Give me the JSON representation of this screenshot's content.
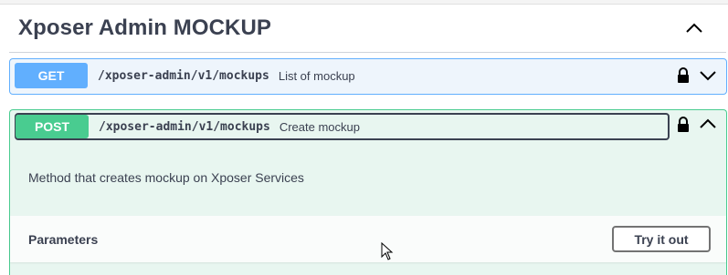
{
  "section": {
    "title": "Xposer Admin MOCKUP",
    "collapse_icon": "chevron-up-icon"
  },
  "operations": [
    {
      "method": "GET",
      "path": "/xposer-admin/v1/mockups",
      "summary": "List of mockup",
      "color": "#61affe",
      "background": "#eef5fc",
      "expanded": false,
      "icons": [
        "lock-icon",
        "chevron-down-icon"
      ]
    },
    {
      "method": "POST",
      "path": "/xposer-admin/v1/mockups",
      "summary": "Create mockup",
      "color": "#49cc90",
      "background": "#e8f6f0",
      "expanded": true,
      "icons": [
        "lock-icon",
        "chevron-up-icon"
      ],
      "description": "Method that creates mockup on Xposer Services",
      "parameters": {
        "title": "Parameters",
        "try_label": "Try it out"
      }
    }
  ],
  "colors": {
    "text": "#3b4151",
    "get": "#61affe",
    "post": "#49cc90"
  }
}
